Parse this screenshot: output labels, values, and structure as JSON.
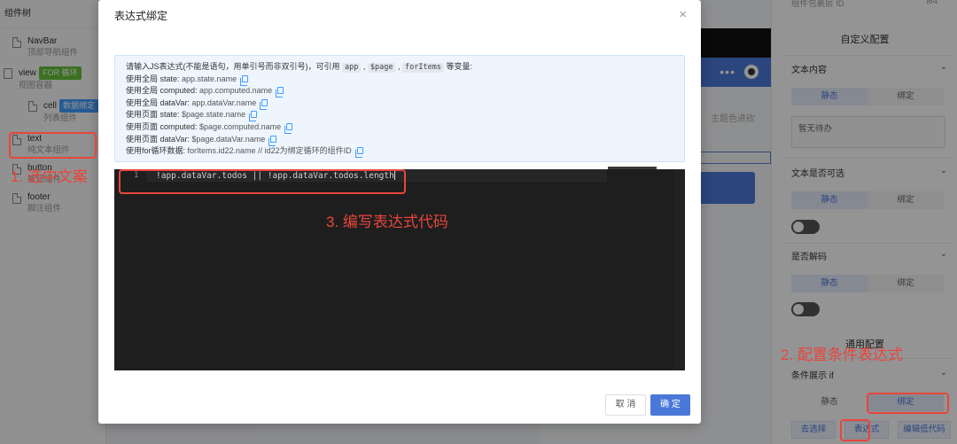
{
  "left_panel": {
    "header": "组件树",
    "items": [
      {
        "name": "NavBar",
        "desc": "顶部导航组件"
      },
      {
        "name": "view",
        "tag": "FOR 循环",
        "desc": "视图容器"
      },
      {
        "name": "cell",
        "tag": "数据绑定",
        "desc": "列表组件"
      },
      {
        "name": "text",
        "desc": "纯文本组件"
      },
      {
        "name": "button",
        "desc": "按钮组件"
      },
      {
        "name": "footer",
        "desc": "脚注组件"
      }
    ]
  },
  "phone": {
    "text": "主题色进砍"
  },
  "right_panel": {
    "top_label": "组件包裹层 ID",
    "top_id": "i64",
    "title": "自定义配置",
    "sections": {
      "text_content": "文本内容",
      "text_selectable": "文本是否可选",
      "decode": "是否解码",
      "general": "通用配置",
      "condition": "条件展示 if"
    },
    "static_label": "静态",
    "bind_label": "绑定",
    "textarea_value": "暂无待办",
    "buttons": {
      "deselect": "去选择",
      "expression": "表达式",
      "low_code": "编辑低代码"
    }
  },
  "modal": {
    "title": "表达式绑定",
    "close": "×",
    "tip_intro": "请输入JS表达式(不能是语句，用单引号而非双引号)，可引用",
    "tip_chips": [
      "app",
      "$page",
      "forItems"
    ],
    "tip_suffix": "等变量:",
    "tip_rows": [
      {
        "label": "使用全局 state:",
        "value": "app.state.name"
      },
      {
        "label": "使用全局 computed:",
        "value": "app.computed.name"
      },
      {
        "label": "使用全局 dataVar:",
        "value": "app.dataVar.name"
      },
      {
        "label": "使用页面 state:",
        "value": "$page.state.name"
      },
      {
        "label": "使用页面 computed:",
        "value": "$page.computed.name"
      },
      {
        "label": "使用页面 dataVar:",
        "value": "$page.dataVar.name"
      },
      {
        "label": "使用for循环数据:",
        "value": "forItems.id22.name // id22为绑定循环的组件ID"
      }
    ],
    "line_number": "1",
    "code": "!app.dataVar.todos || !app.dataVar.todos.length",
    "cancel": "取 消",
    "ok": "确 定"
  },
  "annotations": {
    "step1": "1. 选中文案",
    "step2": "2. 配置条件表达式",
    "step3": "3. 编写表达式代码"
  },
  "colors": {
    "accent": "#4a78d8",
    "annotation": "#e8463c",
    "editor_bg": "#1e1e1e"
  }
}
